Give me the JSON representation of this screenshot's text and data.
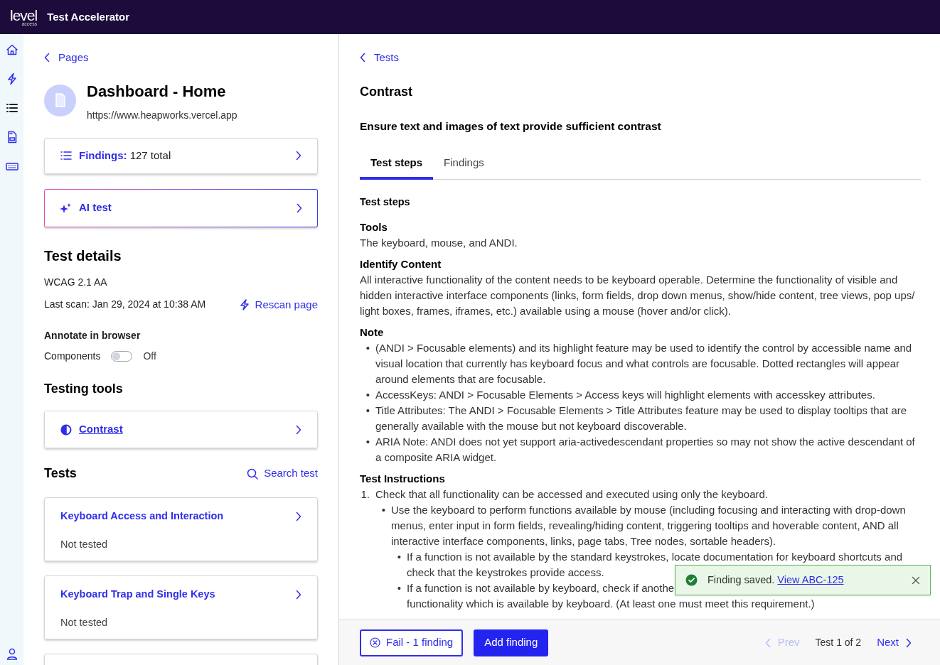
{
  "header": {
    "logo": "level",
    "logo_sub": "access",
    "title": "Test Accelerator"
  },
  "rail": [
    {
      "kind": "home"
    },
    {
      "kind": "bolt"
    },
    {
      "kind": "list"
    },
    {
      "kind": "document"
    },
    {
      "kind": "keyboard"
    },
    {
      "kind": "user"
    }
  ],
  "left": {
    "back": "Pages",
    "page": {
      "title": "Dashboard - Home",
      "url": "https://www.heapworks.vercel.app"
    },
    "findings_card": {
      "label": "Findings:",
      "value": "127 total"
    },
    "ai_card": {
      "label": "AI test"
    },
    "test_details": {
      "heading": "Test details",
      "standard": "WCAG 2.1 AA",
      "last_scan": "Last scan: Jan 29, 2024 at 10:38 AM",
      "rescan": "Rescan page"
    },
    "annotate": {
      "heading": "Annotate in browser",
      "label": "Components",
      "on": false,
      "state_text": "Off"
    },
    "testing_tools": {
      "heading": "Testing tools",
      "tools": [
        {
          "label": "Contrast"
        }
      ]
    },
    "tests": {
      "heading": "Tests",
      "search": "Search test",
      "items": [
        {
          "name": "Keyboard Access and Interaction",
          "status": "Not tested"
        },
        {
          "name": "Keyboard Trap and Single Keys",
          "status": "Not tested"
        }
      ]
    }
  },
  "right": {
    "back": "Tests",
    "title": "Contrast",
    "subtitle": "Ensure text and images of text provide sufficient contrast",
    "tabs": [
      {
        "label": "Test steps",
        "selected": true
      },
      {
        "label": "Findings",
        "selected": false
      }
    ],
    "section_heading": "Test steps",
    "content": [
      {
        "kind": "heading",
        "text": "Tools"
      },
      {
        "kind": "paragraph",
        "text": "The keyboard, mouse, and ANDI."
      },
      {
        "kind": "heading",
        "text": "Identify Content"
      },
      {
        "kind": "paragraph",
        "text": "All interactive functionality of the content needs to be keyboard operable. Determine the functionality of visible and hidden interactive interface components (links, form fields, drop down menus, show/hide content, tree views, pop ups/ light boxes, frames, iframes, etc.) available using a mouse (hover and/or click)."
      },
      {
        "kind": "heading",
        "text": "Note"
      },
      {
        "kind": "list",
        "items": [
          {
            "marker": "•",
            "text": "(ANDI > Focusable elements) and its highlight feature may be used to identify the control by accessible name and visual location that currently has keyboard focus and what controls are focusable. Dotted rectangles will appear around elements that are focusable."
          },
          {
            "marker": "•",
            "text": "AccessKeys: ANDI > Focusable Elements > Access keys will highlight elements with accesskey attributes."
          },
          {
            "marker": "•",
            "text": "Title Attributes: The ANDI > Focusable Elements > Title Attributes feature may be used to display tooltips that are generally available with the mouse but not keyboard discoverable."
          },
          {
            "marker": "•",
            "text": "ARIA Note: ANDI does not yet support aria-activedescendant properties so may not show the active descendant of a composite ARIA widget."
          }
        ]
      },
      {
        "kind": "heading",
        "text": "Test Instructions"
      },
      {
        "kind": "list",
        "items": [
          {
            "marker": "1.",
            "text": "Check that all functionality can be accessed and executed using only the keyboard.",
            "children": [
              {
                "marker": "•",
                "text": "Use the keyboard to perform functions available by mouse (including focusing and interacting with drop-down menus, enter input in form fields, revealing/hiding content, triggering tooltips and hoverable content, AND all interactive interface components, links, page tabs, Tree nodes, sortable headers).",
                "children": [
                  {
                    "marker": "•",
                    "text": "If a function is not available by the standard keystrokes, locate documentation for keyboard shortcuts and",
                    "continuation": "check that the keystrokes provide access."
                  },
                  {
                    "marker": "•",
                    "text": "If a function is not available by keyboard, check if anothe",
                    "continuation": "functionality which is available by keyboard. (At least one must meet this requirement.)"
                  }
                ]
              }
            ]
          }
        ]
      }
    ]
  },
  "footer": {
    "fail": "Fail - 1 finding",
    "add": "Add finding",
    "prev": {
      "label": "Prev",
      "disabled": true
    },
    "position": "Test 1 of 2",
    "next": {
      "label": "Next",
      "disabled": false
    }
  },
  "toast": {
    "message": "Finding saved.",
    "link": "View ABC-125"
  }
}
